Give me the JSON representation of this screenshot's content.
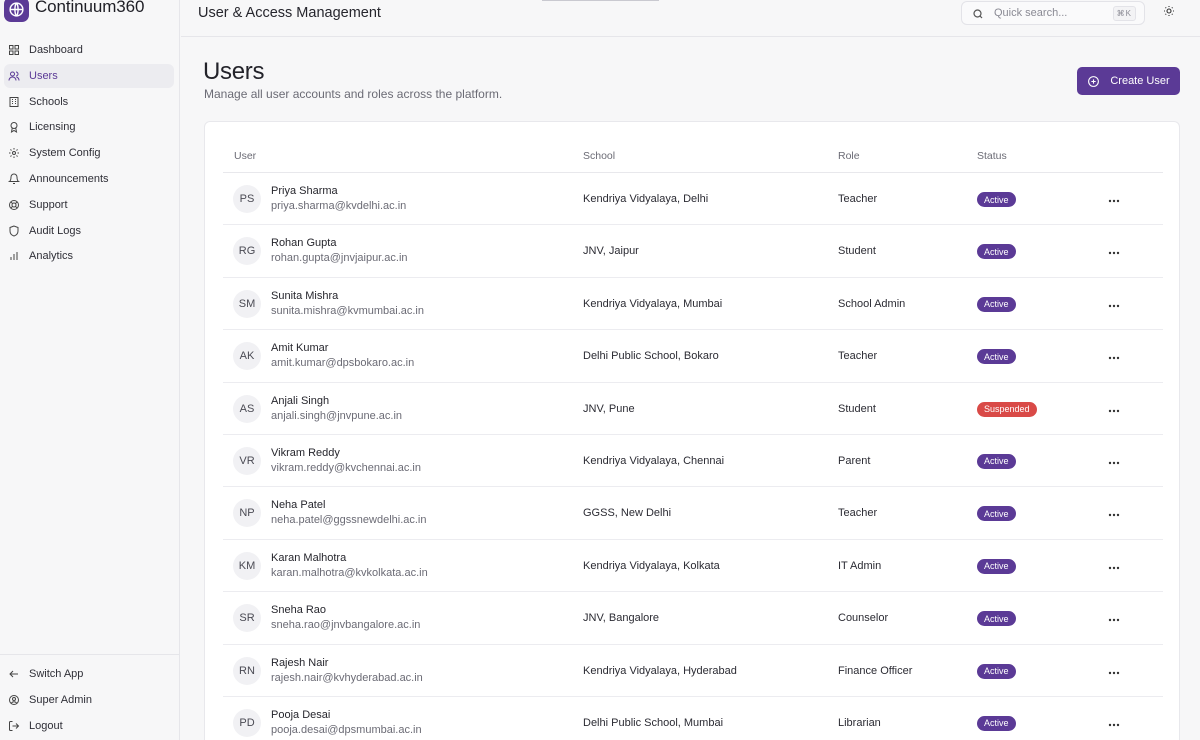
{
  "app": {
    "name": "Continuum360"
  },
  "sidebar": {
    "items": [
      {
        "label": "Dashboard",
        "icon": "dashboard-icon"
      },
      {
        "label": "Users",
        "icon": "users-icon",
        "active": true
      },
      {
        "label": "Schools",
        "icon": "building-icon"
      },
      {
        "label": "Licensing",
        "icon": "award-icon"
      },
      {
        "label": "System Config",
        "icon": "gear-icon"
      },
      {
        "label": "Announcements",
        "icon": "bell-icon"
      },
      {
        "label": "Support",
        "icon": "lifebuoy-icon"
      },
      {
        "label": "Audit Logs",
        "icon": "shield-icon"
      },
      {
        "label": "Analytics",
        "icon": "bar-chart-icon"
      }
    ],
    "bottom": [
      {
        "label": "Switch App",
        "icon": "arrow-left-icon"
      },
      {
        "label": "Super Admin",
        "icon": "user-circle-icon"
      },
      {
        "label": "Logout",
        "icon": "logout-icon"
      }
    ]
  },
  "header": {
    "title": "User & Access Management",
    "search_placeholder": "Quick search...",
    "search_shortcut": "⌘K"
  },
  "page": {
    "title": "Users",
    "subtitle": "Manage all user accounts and roles across the platform.",
    "create_label": "Create User"
  },
  "table": {
    "columns": [
      "User",
      "School",
      "Role",
      "Status"
    ],
    "rows": [
      {
        "initials": "PS",
        "name": "Priya Sharma",
        "email": "priya.sharma@kvdelhi.ac.in",
        "school": "Kendriya Vidyalaya, Delhi",
        "role": "Teacher",
        "status": "Active"
      },
      {
        "initials": "RG",
        "name": "Rohan Gupta",
        "email": "rohan.gupta@jnvjaipur.ac.in",
        "school": "JNV, Jaipur",
        "role": "Student",
        "status": "Active"
      },
      {
        "initials": "SM",
        "name": "Sunita Mishra",
        "email": "sunita.mishra@kvmumbai.ac.in",
        "school": "Kendriya Vidyalaya, Mumbai",
        "role": "School Admin",
        "status": "Active"
      },
      {
        "initials": "AK",
        "name": "Amit Kumar",
        "email": "amit.kumar@dpsbokaro.ac.in",
        "school": "Delhi Public School, Bokaro",
        "role": "Teacher",
        "status": "Active"
      },
      {
        "initials": "AS",
        "name": "Anjali Singh",
        "email": "anjali.singh@jnvpune.ac.in",
        "school": "JNV, Pune",
        "role": "Student",
        "status": "Suspended"
      },
      {
        "initials": "VR",
        "name": "Vikram Reddy",
        "email": "vikram.reddy@kvchennai.ac.in",
        "school": "Kendriya Vidyalaya, Chennai",
        "role": "Parent",
        "status": "Active"
      },
      {
        "initials": "NP",
        "name": "Neha Patel",
        "email": "neha.patel@ggssnewdelhi.ac.in",
        "school": "GGSS, New Delhi",
        "role": "Teacher",
        "status": "Active"
      },
      {
        "initials": "KM",
        "name": "Karan Malhotra",
        "email": "karan.malhotra@kvkolkata.ac.in",
        "school": "Kendriya Vidyalaya, Kolkata",
        "role": "IT Admin",
        "status": "Active"
      },
      {
        "initials": "SR",
        "name": "Sneha Rao",
        "email": "sneha.rao@jnvbangalore.ac.in",
        "school": "JNV, Bangalore",
        "role": "Counselor",
        "status": "Active"
      },
      {
        "initials": "RN",
        "name": "Rajesh Nair",
        "email": "rajesh.nair@kvhyderabad.ac.in",
        "school": "Kendriya Vidyalaya, Hyderabad",
        "role": "Finance Officer",
        "status": "Active"
      },
      {
        "initials": "PD",
        "name": "Pooja Desai",
        "email": "pooja.desai@dpsmumbai.ac.in",
        "school": "Delhi Public School, Mumbai",
        "role": "Librarian",
        "status": "Active"
      }
    ]
  },
  "colors": {
    "accent": "#5b3a96",
    "danger": "#d94a47"
  }
}
